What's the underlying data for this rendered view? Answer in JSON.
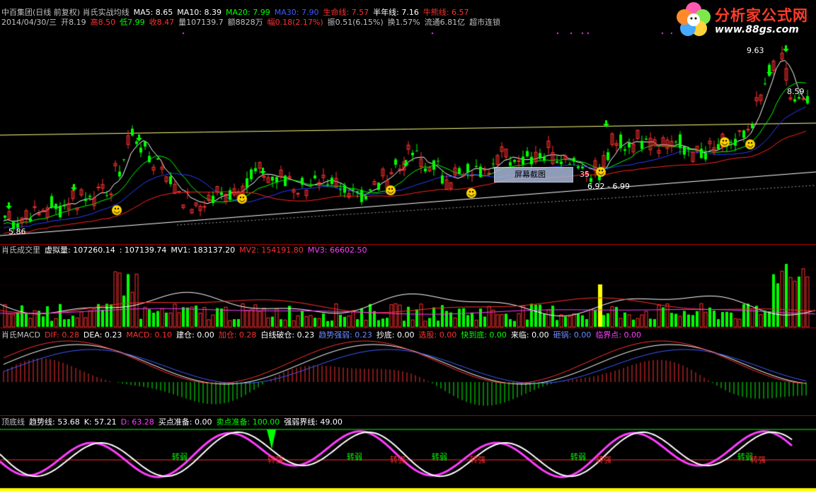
{
  "header": {
    "line1": [
      {
        "t": "中百集团(日线 前复权) 肖氏实战均线",
        "c": "#c0c0c0"
      },
      {
        "t": "MA5: 8.65",
        "c": "#ffffff"
      },
      {
        "t": "MA10: 8.39",
        "c": "#ffffff"
      },
      {
        "t": "MA20: 7.99",
        "c": "#00ff00"
      },
      {
        "t": "MA30: 7.90",
        "c": "#3b5bff"
      },
      {
        "t": "生命线: 7.57",
        "c": "#ff3030"
      },
      {
        "t": "半年线: 7.16",
        "c": "#ffffff"
      },
      {
        "t": "牛熊线: 6.57",
        "c": "#ff3030"
      }
    ],
    "line2": [
      {
        "t": "2014/04/30/三",
        "c": "#c0c0c0"
      },
      {
        "t": "开8.19",
        "c": "#c0c0c0"
      },
      {
        "t": "高8.50",
        "c": "#ff3030"
      },
      {
        "t": "低7.99",
        "c": "#00ff00"
      },
      {
        "t": "收8.47",
        "c": "#ff3030"
      },
      {
        "t": "量107139.7",
        "c": "#c0c0c0"
      },
      {
        "t": "额8828万",
        "c": "#c0c0c0"
      },
      {
        "t": "幅0.18(2.17%)",
        "c": "#ff3030"
      },
      {
        "t": "振0.51(6.15%)",
        "c": "#c0c0c0"
      },
      {
        "t": "换1.57%",
        "c": "#c0c0c0"
      },
      {
        "t": "流通6.81亿",
        "c": "#c0c0c0"
      },
      {
        "t": "超市连锁",
        "c": "#c0c0c0"
      }
    ]
  },
  "logo": {
    "name": "分析家公式网",
    "url_text": "www.88gs.com"
  },
  "price_labels": {
    "high": "9.63",
    "right": "8.59",
    "low": "5.86",
    "mid": "6.92 - 6.99",
    "screenshot": "屏幕截图",
    "screenshot_num": "35"
  },
  "volume_header": [
    {
      "t": "肖氏成交里",
      "c": "#c0c0c0"
    },
    {
      "t": "虚拟量: 107260.14",
      "c": "#ffffff"
    },
    {
      "t": ": 107139.74",
      "c": "#ffffff"
    },
    {
      "t": "MV1: 183137.20",
      "c": "#ffffff"
    },
    {
      "t": "MV2: 154191.80",
      "c": "#ff3030"
    },
    {
      "t": "MV3: 66602.50",
      "c": "#ff3cff"
    }
  ],
  "macd_header": [
    {
      "t": "肖氏MACD",
      "c": "#c0c0c0"
    },
    {
      "t": "DIF: 0.28",
      "c": "#ff3030"
    },
    {
      "t": "DEA: 0.23",
      "c": "#ffffff"
    },
    {
      "t": "MACD: 0.10",
      "c": "#ff3030"
    },
    {
      "t": "建仓: 0.00",
      "c": "#ffffff"
    },
    {
      "t": "加仓: 0.28",
      "c": "#ff3030"
    },
    {
      "t": "白线破仓: 0.23",
      "c": "#ffffff"
    },
    {
      "t": "趋势强弱: 0.23",
      "c": "#6c8cff"
    },
    {
      "t": "抄底: 0.00",
      "c": "#ffffff"
    },
    {
      "t": "选股: 0.00",
      "c": "#ff3030"
    },
    {
      "t": "快到底: 0.00",
      "c": "#00ff00"
    },
    {
      "t": "来临: 0.00",
      "c": "#ffffff"
    },
    {
      "t": "砸锅: 0.00",
      "c": "#6c8cff"
    },
    {
      "t": "临界点: 0.00",
      "c": "#ff3cff"
    }
  ],
  "kd_header": [
    {
      "t": "顶底线",
      "c": "#c0c0c0"
    },
    {
      "t": "趋势线: 53.68",
      "c": "#ffffff"
    },
    {
      "t": "K: 57.21",
      "c": "#ffffff"
    },
    {
      "t": "D: 63.28",
      "c": "#ff3cff"
    },
    {
      "t": "买点准备: 0.00",
      "c": "#ffffff"
    },
    {
      "t": "卖点准备: 100.00",
      "c": "#00ff00"
    },
    {
      "t": "强弱界线: 49.00",
      "c": "#ffffff"
    }
  ],
  "kd_labels": {
    "weak": "转弱",
    "strong": "转强"
  },
  "colors": {
    "up": "#ff3030",
    "down": "#00ff00",
    "ma5": "#ffffff",
    "ma20": "#00ff00",
    "ma30": "#2a3cff",
    "life": "#ff2020",
    "panel_border": "#a00000"
  }
}
